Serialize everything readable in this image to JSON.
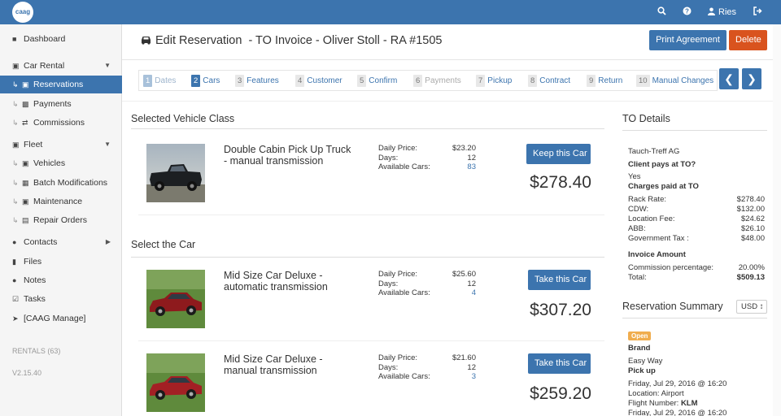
{
  "topbar": {
    "logo": "caag",
    "user": "Ries",
    "icons": [
      "search-icon",
      "help-icon",
      "user-icon",
      "logout-icon"
    ]
  },
  "sidebar": {
    "dashboard": "Dashboard",
    "car_rental": "Car Rental",
    "reservations": "Reservations",
    "payments": "Payments",
    "commissions": "Commissions",
    "fleet": "Fleet",
    "vehicles": "Vehicles",
    "batch_modifications": "Batch Modifications",
    "maintenance": "Maintenance",
    "repair_orders": "Repair Orders",
    "contacts": "Contacts",
    "files": "Files",
    "notes": "Notes",
    "tasks": "Tasks",
    "caag_manage": "[CAAG Manage]",
    "rentals": "RENTALS (63)",
    "version": "V2.15.40"
  },
  "header": {
    "title": "Edit Reservation",
    "subtitle": "- TO Invoice - Oliver Stoll - RA #1505",
    "print_label": "Print Agreement",
    "delete_label": "Delete"
  },
  "steps": [
    {
      "num": "1",
      "label": "Dates"
    },
    {
      "num": "2",
      "label": "Cars"
    },
    {
      "num": "3",
      "label": "Features"
    },
    {
      "num": "4",
      "label": "Customer"
    },
    {
      "num": "5",
      "label": "Confirm"
    },
    {
      "num": "6",
      "label": "Payments"
    },
    {
      "num": "7",
      "label": "Pickup"
    },
    {
      "num": "8",
      "label": "Contract"
    },
    {
      "num": "9",
      "label": "Return"
    },
    {
      "num": "10",
      "label": "Manual Changes"
    }
  ],
  "selected": {
    "title": "Selected Vehicle Class",
    "name": "Double Cabin Pick Up Truck - manual transmission",
    "daily_price_label": "Daily Price:",
    "days_label": "Days:",
    "available_label": "Available Cars:",
    "daily_price": "$23.20",
    "days": "12",
    "available": "83",
    "button": "Keep this Car",
    "total": "$278.40"
  },
  "select_title": "Select the Car",
  "cars": [
    {
      "name": "Mid Size Car Deluxe - automatic transmission",
      "daily_price_label": "Daily Price:",
      "days_label": "Days:",
      "available_label": "Available Cars:",
      "daily_price": "$25.60",
      "days": "12",
      "available": "4",
      "button": "Take this Car",
      "total": "$307.20"
    },
    {
      "name": "Mid Size Car Deluxe - manual transmission",
      "daily_price_label": "Daily Price:",
      "days_label": "Days:",
      "available_label": "Available Cars:",
      "daily_price": "$21.60",
      "days": "12",
      "available": "3",
      "button": "Take this Car",
      "total": "$259.20"
    }
  ],
  "to_details": {
    "title": "TO Details",
    "company": "Tauch-Treff AG",
    "client_pays_label": "Client pays at TO?",
    "client_pays_value": "Yes",
    "charges_label": "Charges paid at TO",
    "rows": [
      {
        "label": "Rack Rate:",
        "value": "$278.40"
      },
      {
        "label": "CDW:",
        "value": "$132.00"
      },
      {
        "label": "Location Fee:",
        "value": "$24.62"
      },
      {
        "label": "ABB:",
        "value": "$26.10"
      },
      {
        "label": "Government Tax :",
        "value": "$48.00"
      }
    ],
    "invoice_label": "Invoice Amount",
    "commission_label": "Commission percentage:",
    "commission_value": "20.00%",
    "total_label": "Total:",
    "total_value": "$509.13"
  },
  "summary": {
    "title": "Reservation Summary",
    "currency": "USD ↕",
    "badge": "Open",
    "brand_label": "Brand",
    "brand_value": "Easy Way",
    "pickup_label": "Pick up",
    "pickup_date": "Friday, Jul 29, 2016 @ 16:20",
    "location": "Location: Airport",
    "flight_prefix": "Flight Number: ",
    "flight": "KLM",
    "return_date": "Friday, Jul 29, 2016 @ 16:20"
  }
}
